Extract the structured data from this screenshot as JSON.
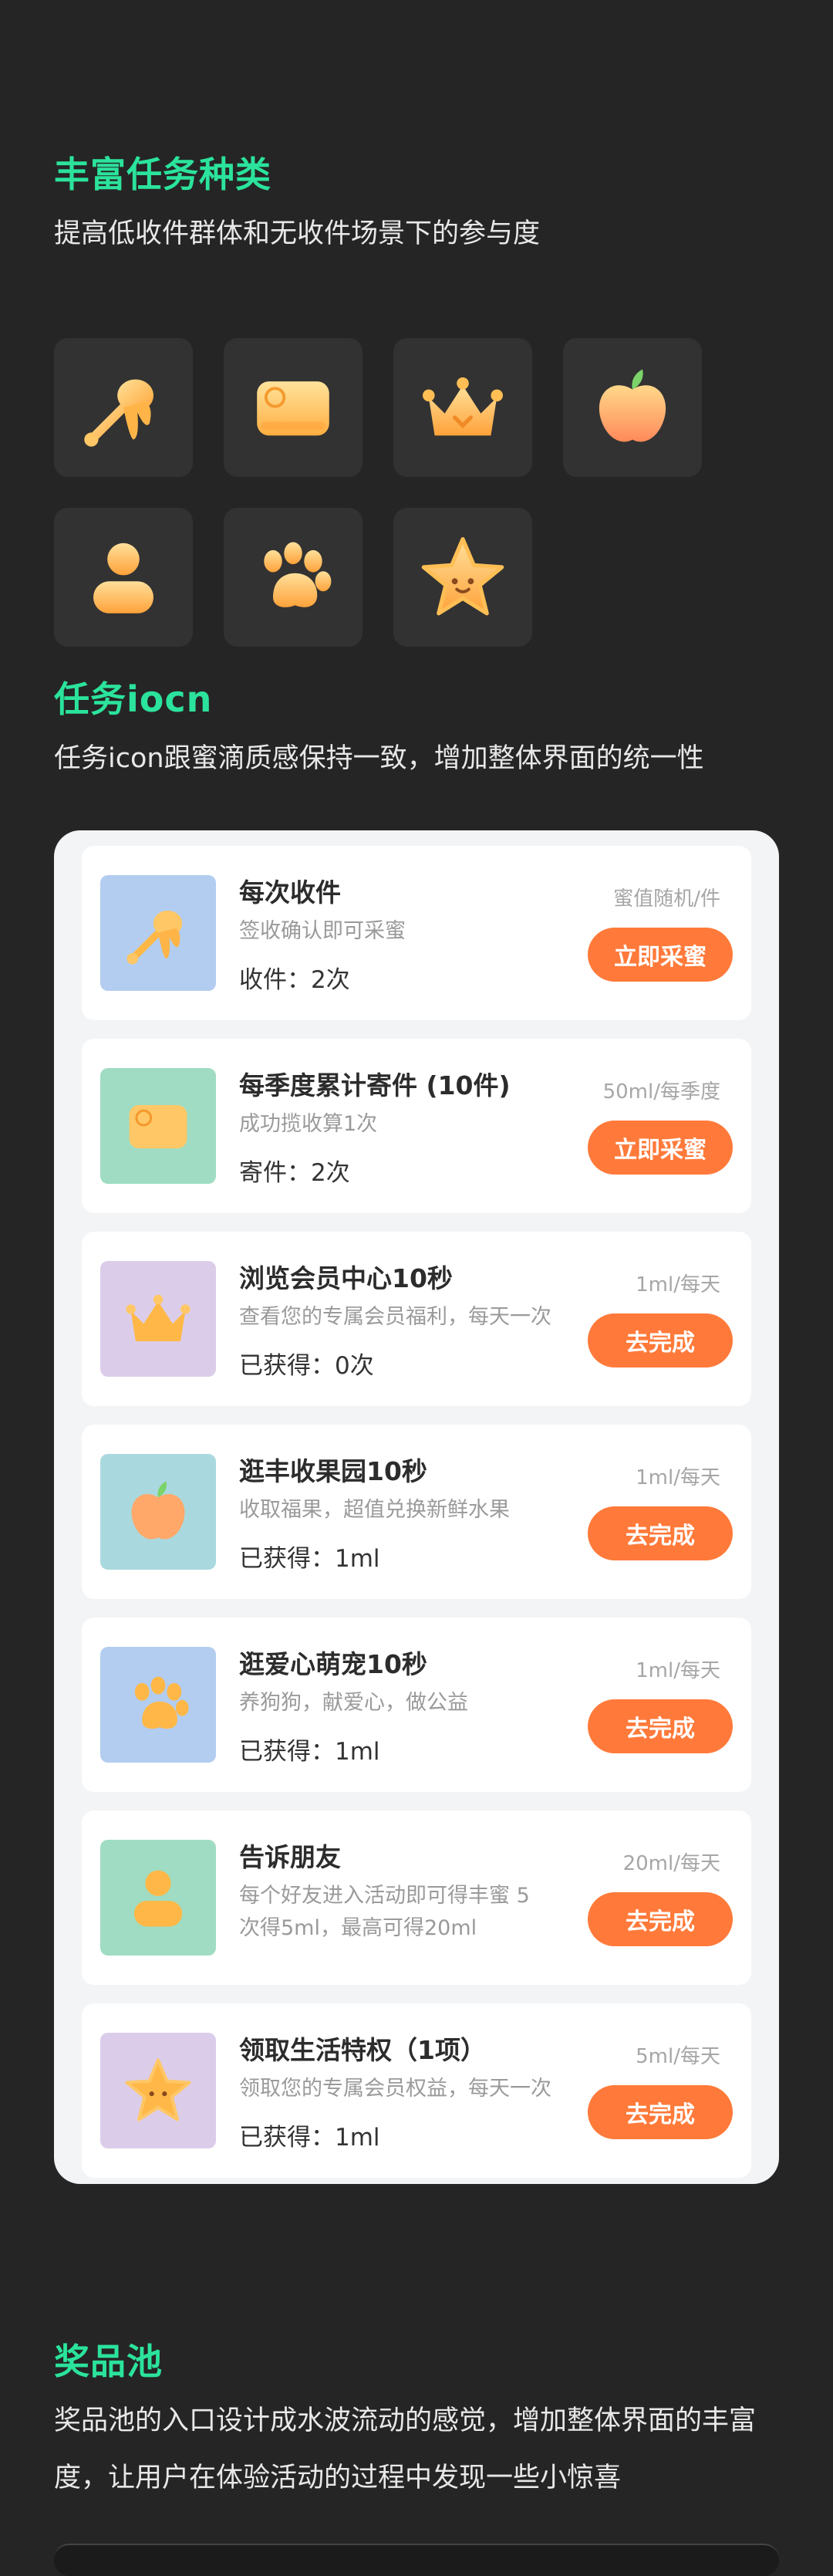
{
  "section1": {
    "title": "丰富任务种类",
    "subtitle": "提高低收件群体和无收件场景下的参与度"
  },
  "icons": [
    {
      "name": "honey-dipper-icon"
    },
    {
      "name": "sf-card-icon"
    },
    {
      "name": "crown-icon"
    },
    {
      "name": "apple-icon"
    },
    {
      "name": "person-icon"
    },
    {
      "name": "paw-icon"
    },
    {
      "name": "star-icon"
    }
  ],
  "section2": {
    "title": "任务iocn",
    "subtitle": "任务icon跟蜜滴质感保持一致，增加整体界面的统一性"
  },
  "tasks": [
    {
      "title": "每次收件",
      "desc": "签收确认即可采蜜",
      "count": "收件：2次",
      "reward": "蜜值随机/件",
      "button": "立即采蜜",
      "icon": "honey-dipper-icon",
      "thumb_color": "#b3cdf0"
    },
    {
      "title": "每季度累计寄件 (10件)",
      "desc": "成功揽收算1次",
      "count": "寄件：2次",
      "reward": "50ml/每季度",
      "button": "立即采蜜",
      "icon": "sf-card-icon",
      "thumb_color": "#9fdcc3"
    },
    {
      "title": "浏览会员中心10秒",
      "desc": "查看您的专属会员福利，每天一次",
      "count": "已获得：0次",
      "reward": "1ml/每天",
      "button": "去完成",
      "icon": "crown-icon",
      "thumb_color": "#dbcdea"
    },
    {
      "title": "逛丰收果园10秒",
      "desc": "收取福果，超值兑换新鲜水果",
      "count": "已获得：1ml",
      "reward": "1ml/每天",
      "button": "去完成",
      "icon": "apple-icon",
      "thumb_color": "#a9d9de"
    },
    {
      "title": "逛爱心萌宠10秒",
      "desc": "养狗狗，献爱心，做公益",
      "count": "已获得：1ml",
      "reward": "1ml/每天",
      "button": "去完成",
      "icon": "paw-icon",
      "thumb_color": "#b3cdf0"
    },
    {
      "title": "告诉朋友",
      "desc": "每个好友进入活动即可得丰蜜 5次得5ml，最高可得20ml",
      "count": "",
      "reward": "20ml/每天",
      "button": "去完成",
      "icon": "person-icon",
      "thumb_color": "#9fdcc3"
    },
    {
      "title": "领取生活特权（1项）",
      "desc": "领取您的专属会员权益，每天一次",
      "count": "已获得：1ml",
      "reward": "5ml/每天",
      "button": "去完成",
      "icon": "star-icon",
      "thumb_color": "#dbcdea"
    }
  ],
  "section3": {
    "title": "奖品池",
    "subtitle": "奖品池的入口设计成水波流动的感觉，增加整体界面的丰富度，让用户在体验活动的过程中发现一些小惊喜"
  }
}
